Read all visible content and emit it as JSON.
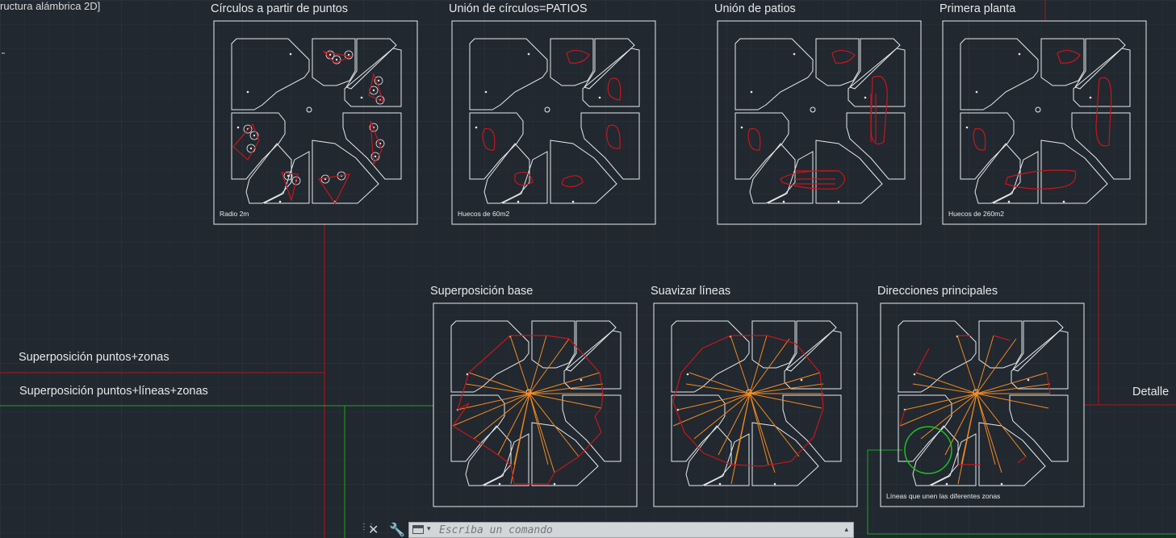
{
  "viewport_label": "ructura alámbrica 2D]",
  "panels": [
    {
      "title": "Círculos a partir de puntos",
      "caption": "Radio 2m"
    },
    {
      "title": "Unión de círculos=PATIOS",
      "caption": "Huecos de 60m2"
    },
    {
      "title": "Unión de patios",
      "caption": ""
    },
    {
      "title": "Primera planta",
      "caption": "Huecos de 260m2"
    },
    {
      "title": "Superposición base",
      "caption": ""
    },
    {
      "title": "Suavizar líneas",
      "caption": ""
    },
    {
      "title": "Direcciones principales",
      "caption": "Líneas que unen las diferentes zonas"
    }
  ],
  "side_labels": {
    "overlay_points_zones": "Superposición puntos+zonas",
    "overlay_points_lines_zones": "Superposición puntos+líneas+zonas",
    "detail": "Detalle"
  },
  "command_line": {
    "placeholder": "Escriba un comando",
    "close_icon": "close-icon",
    "customize_icon": "wrench-icon",
    "history_icon": "terminal-icon"
  },
  "colors": {
    "background": "#212830",
    "grid_minor": "#283039",
    "grid_major": "#2f3845",
    "linework": "#e8eaec",
    "red": "#c8161b",
    "orange": "#f58a1f",
    "green": "#1ec21e"
  }
}
